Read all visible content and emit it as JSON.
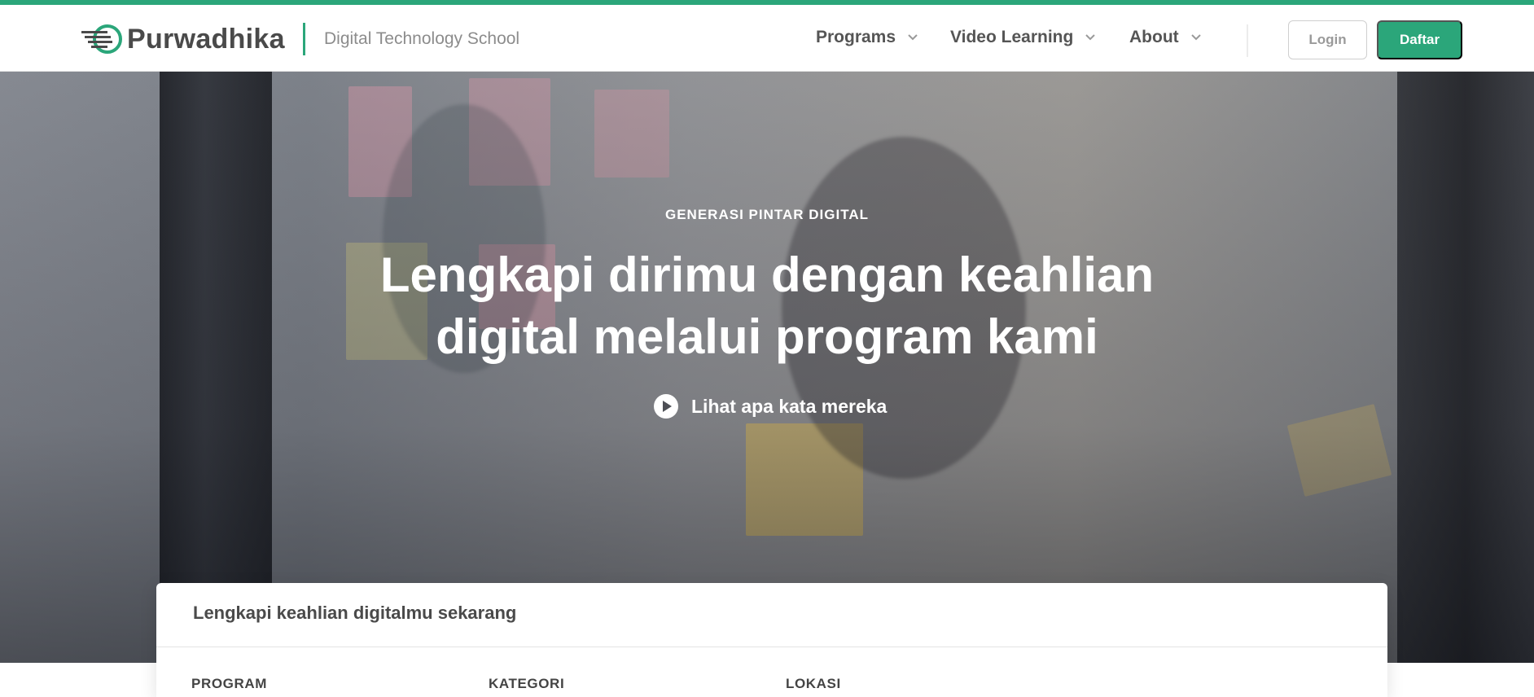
{
  "brand": {
    "name": "Purwadhika",
    "tagline": "Digital Technology School",
    "accent_color": "#2ba67a"
  },
  "nav": {
    "items": [
      {
        "label": "Programs",
        "icon": "chevron-down-icon"
      },
      {
        "label": "Video Learning",
        "icon": "chevron-down-icon"
      },
      {
        "label": "About",
        "icon": "chevron-down-icon"
      }
    ],
    "login_label": "Login",
    "daftar_label": "Daftar"
  },
  "hero": {
    "eyebrow": "GENERASI PINTAR DIGITAL",
    "title_line1": "Lengkapi dirimu dengan keahlian",
    "title_line2": "digital melalui program kami",
    "cta_label": "Lihat apa kata mereka",
    "cta_icon": "play-icon"
  },
  "search_card": {
    "title": "Lengkapi keahlian digitalmu sekarang",
    "fields": [
      "PROGRAM",
      "KATEGORI",
      "LOKASI"
    ]
  }
}
